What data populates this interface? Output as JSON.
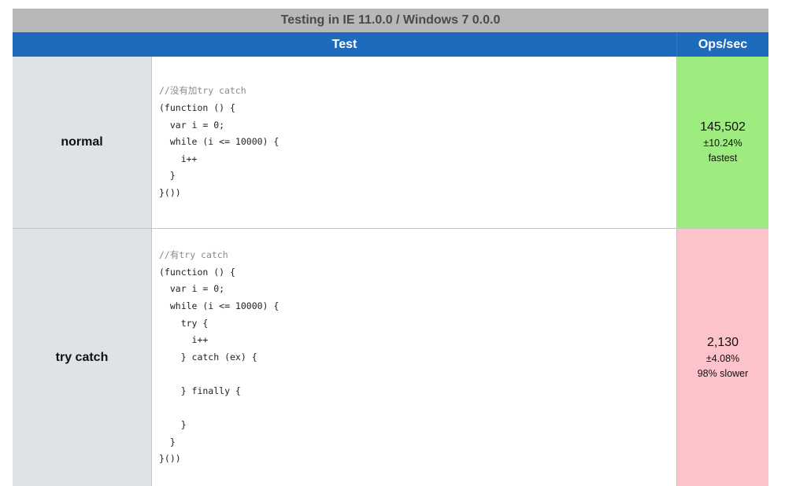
{
  "title": "Testing in IE 11.0.0 / Windows 7 0.0.0",
  "columns": {
    "test": "Test",
    "ops": "Ops/sec"
  },
  "colors": {
    "title_bg": "#b8b8b8",
    "header_bg": "#1e6bbd",
    "name_bg": "#dee3e8",
    "fastest_bg": "#9eec7f",
    "slower_bg": "#fdc3ca"
  },
  "tests": [
    {
      "name": "normal",
      "code": [
        "//没有加try catch",
        "(function () {",
        "  var i = 0;",
        "  while (i <= 10000) {",
        "    i++",
        "  }",
        "}())"
      ],
      "ops": "145,502",
      "error": "±10.24%",
      "rank": "fastest"
    },
    {
      "name": "try catch",
      "code": [
        "//有try catch",
        "(function () {",
        "  var i = 0;",
        "  while (i <= 10000) {",
        "    try {",
        "      i++",
        "    } catch (ex) {",
        "",
        "    } finally {",
        "",
        "    }",
        "  }",
        "}())"
      ],
      "ops": "2,130",
      "error": "±4.08%",
      "rank": "98% slower"
    }
  ]
}
